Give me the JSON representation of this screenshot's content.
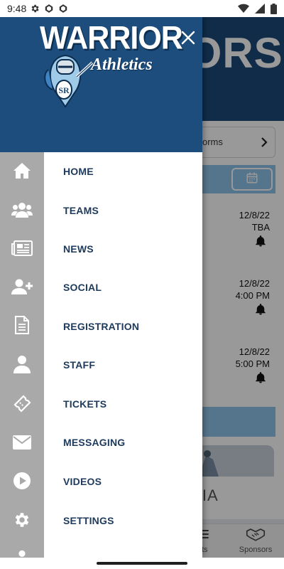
{
  "status_bar": {
    "time": "9:48",
    "left_icons": [
      "gear-icon",
      "app-icon",
      "app-icon"
    ],
    "right_icons": [
      "wifi-icon",
      "signal-icon",
      "battery-icon"
    ]
  },
  "background_app": {
    "header_text": "IORS",
    "forms_button_label": "orms",
    "events": [
      {
        "date": "12/8/22",
        "time": "TBA"
      },
      {
        "date": "12/8/22",
        "time": "4:00 PM"
      },
      {
        "date": "12/8/22",
        "time": "5:00 PM"
      }
    ],
    "media_heading": "DIA",
    "tabs": [
      {
        "label": "lts",
        "icon": "list-icon"
      },
      {
        "label": "Sponsors",
        "icon": "handshake-icon"
      }
    ]
  },
  "drawer": {
    "logo": {
      "title": "WARRIOR",
      "subtitle": "Athletics",
      "monogram": "SR"
    },
    "menu_items": [
      {
        "label": "HOME",
        "icon": "home-icon"
      },
      {
        "label": "TEAMS",
        "icon": "users-icon"
      },
      {
        "label": "NEWS",
        "icon": "newspaper-icon"
      },
      {
        "label": "SOCIAL",
        "icon": "user-plus-icon"
      },
      {
        "label": "REGISTRATION",
        "icon": "document-icon"
      },
      {
        "label": "STAFF",
        "icon": "user-icon"
      },
      {
        "label": "TICKETS",
        "icon": "ticket-icon"
      },
      {
        "label": "MESSAGING",
        "icon": "envelope-icon"
      },
      {
        "label": "VIDEOS",
        "icon": "play-icon"
      },
      {
        "label": "SETTINGS",
        "icon": "gear-icon"
      }
    ]
  },
  "colors": {
    "drawer_header": "#1d4d7c",
    "icon_rail": "#a9a9a9",
    "menu_text": "#1d3a5c",
    "accent_light_blue": "#8ec4ea"
  }
}
